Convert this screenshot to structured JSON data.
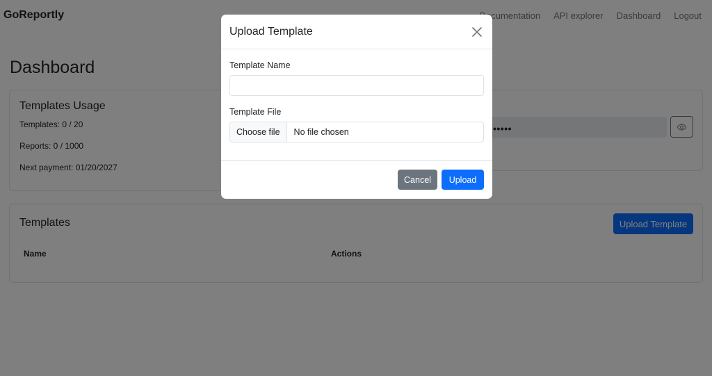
{
  "navbar": {
    "brand": "GoReportly",
    "links": [
      "Documentation",
      "API explorer",
      "Dashboard",
      "Logout"
    ]
  },
  "page": {
    "title": "Dashboard"
  },
  "usage": {
    "title": "Templates Usage",
    "templates": "Templates: 0 / 20",
    "reports": "Reports: 0 / 1000",
    "next_payment": "Next payment: 01/20/2027"
  },
  "api_key": {
    "masked": "•••••",
    "reveal_icon": "eye-icon"
  },
  "templates": {
    "title": "Templates",
    "upload_label": "Upload Template",
    "columns": [
      "Name",
      "Actions"
    ]
  },
  "modal": {
    "title": "Upload Template",
    "close_icon": "close-icon",
    "name_label": "Template Name",
    "name_value": "",
    "file_label": "Template File",
    "choose_file": "Choose file",
    "file_status": "No file chosen",
    "cancel": "Cancel",
    "upload": "Upload"
  },
  "colors": {
    "primary": "#0d6efd",
    "secondary": "#6c757d",
    "backdrop": "rgba(0,0,0,0.5)"
  }
}
